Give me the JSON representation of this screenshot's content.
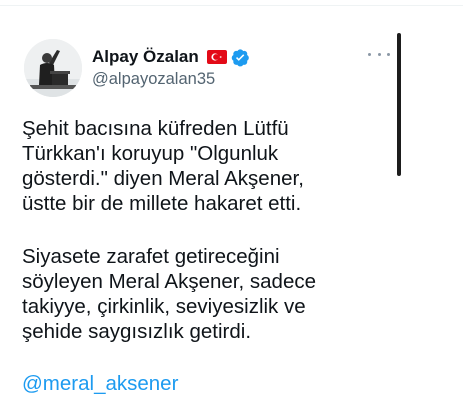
{
  "tweet": {
    "author": {
      "name": "Alpay Özalan",
      "handle": "@alpayozalan35",
      "avatar_icon": "avatar-photo",
      "flag_icon": "turkish-flag-icon",
      "verified_icon": "verified-badge-icon"
    },
    "more_icon": "more-options-icon",
    "paragraphs": [
      {
        "lines": [
          "Şehit bacısına küfreden Lütfü",
          "Türkkan'ı koruyup \"Olgunluk",
          "gösterdi.\" diyen Meral Akşener,",
          "üstte bir de millete hakaret etti."
        ]
      },
      {
        "lines": [
          "Siyasete zarafet getireceğini",
          "söyleyen Meral Akşener, sadece",
          "takiyye, çirkinlik, seviyesizlik ve",
          "şehide saygısızlık getirdi."
        ]
      }
    ],
    "mention": "@meral_aksener"
  },
  "colors": {
    "text": "#0f1419",
    "secondary": "#536471",
    "link": "#1d9bf0",
    "verified": "#1d9bf0",
    "flag_red": "#e30a17"
  }
}
